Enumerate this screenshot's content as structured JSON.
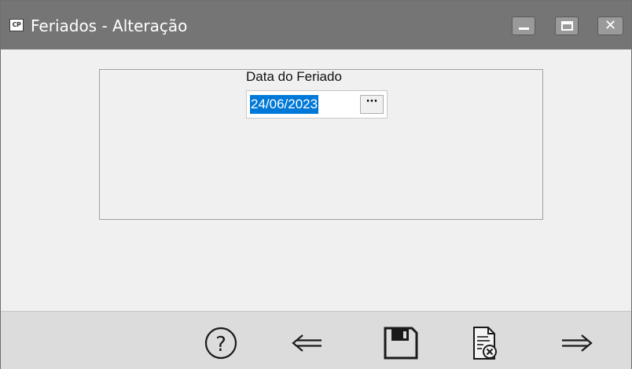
{
  "window": {
    "title": "Feriados - Alteração",
    "icon_text": "CP",
    "buttons": [
      "minimize-icon",
      "maximize-icon",
      "close-icon"
    ]
  },
  "form": {
    "date_label": "Data do Feriado",
    "date_value": "24/06/2023",
    "date_picker_label": "···"
  },
  "toolbar": {
    "buttons": [
      {
        "name": "help",
        "icon": "help-icon"
      },
      {
        "name": "previous",
        "icon": "arrow-left-icon"
      },
      {
        "name": "save",
        "icon": "floppy-disk-icon"
      },
      {
        "name": "cancel",
        "icon": "cancel-document-icon"
      },
      {
        "name": "next",
        "icon": "arrow-right-icon"
      }
    ]
  },
  "colors": {
    "titlebar": "#757575",
    "selection": "#0078d7",
    "toolbar": "#dcdcdc",
    "background": "#f0f0f0"
  }
}
